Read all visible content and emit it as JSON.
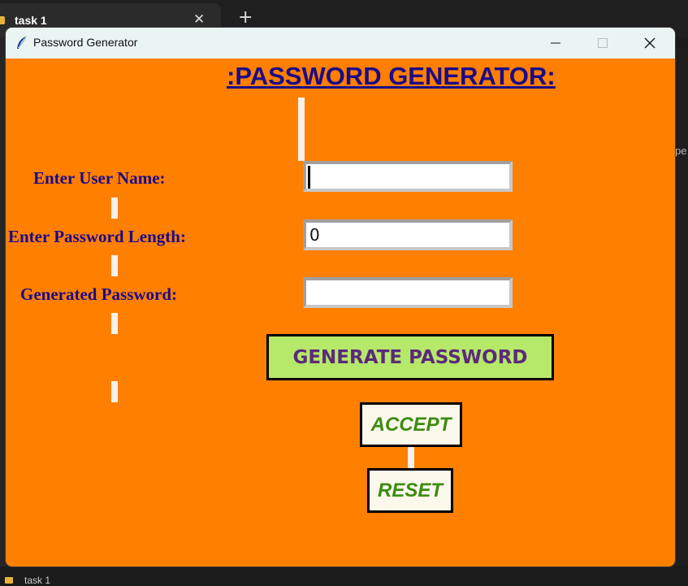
{
  "background": {
    "tab_title": "task 1",
    "tab_close_glyph": "✕",
    "new_tab_glyph": "+",
    "right_fragment": "pe",
    "bottom_label": "task 1"
  },
  "window": {
    "title": "Password Generator",
    "icon": "feather-icon",
    "bg_color": "#ff7f00"
  },
  "app": {
    "heading": ":PASSWORD GENERATOR:",
    "username_label": "Enter User Name:",
    "length_label": "Enter Password Length:",
    "generated_label": "Generated Password:",
    "username_value": "",
    "length_value": "0",
    "generated_value": "",
    "generate_button": "GENERATE PASSWORD",
    "accept_button": "ACCEPT",
    "reset_button": "RESET",
    "text_color": "#1b0a8a",
    "generate_bg": "#b6e86a",
    "small_btn_text": "#3c8c10"
  }
}
